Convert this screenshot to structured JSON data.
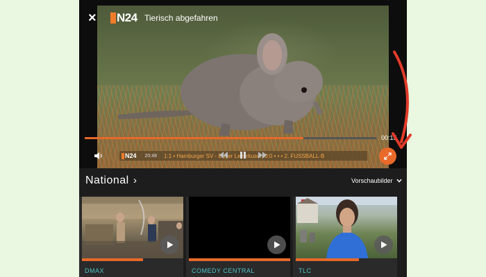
{
  "player": {
    "close_label": "×",
    "logo_text": "N24",
    "title": "Tierisch abgefahren",
    "time": "00:15",
    "progress": 0.75,
    "ticker": {
      "logo_text": "N24",
      "time": "20:48",
      "text": "1:1 • Hamburger SV - Bayer Leverkusen 0:0 • • • 2. FUSSBALL-B"
    }
  },
  "section": {
    "title": "National",
    "chevron": "›",
    "preview_label": "Vorschaubilder"
  },
  "cards": [
    {
      "label": "DMAX",
      "progress": 0.6
    },
    {
      "label": "COMEDY CENTRAL",
      "progress": 1.0
    },
    {
      "label": "TLC",
      "progress": 0.62
    }
  ],
  "colors": {
    "accent": "#e8692a",
    "channel_label": "#4fc3c7",
    "annotation_arrow": "#e23b2a",
    "page_bg": "#eaf7e1"
  }
}
